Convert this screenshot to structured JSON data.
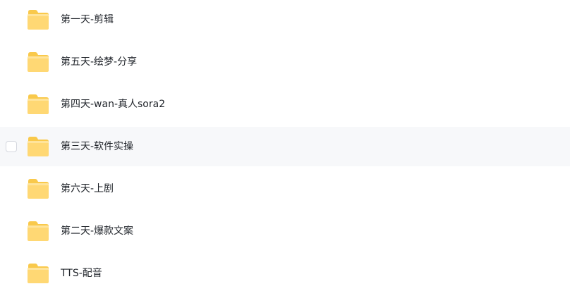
{
  "file_list": {
    "icon": "folder-icon",
    "accent_color": "#ffd266",
    "hover_background": "#f7f8fa",
    "items": [
      {
        "name": "第一天-剪辑",
        "hovered": false
      },
      {
        "name": "第五天-绘梦-分享",
        "hovered": false
      },
      {
        "name": "第四天-wan-真人sora2",
        "hovered": false
      },
      {
        "name": "第三天-软件实操",
        "hovered": true
      },
      {
        "name": "第六天-上剧",
        "hovered": false
      },
      {
        "name": "第二天-爆款文案",
        "hovered": false
      },
      {
        "name": "TTS-配音",
        "hovered": false
      }
    ]
  }
}
